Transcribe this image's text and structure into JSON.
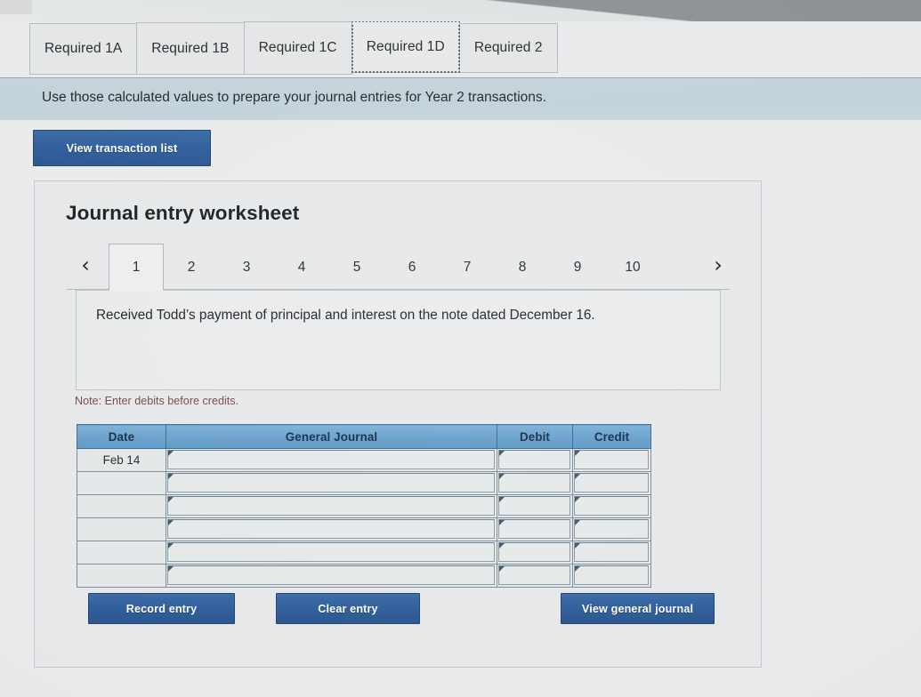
{
  "required_tabs": [
    {
      "label": "Required 1A",
      "active": false
    },
    {
      "label": "Required 1B",
      "active": false
    },
    {
      "label": "Required 1C",
      "active": false
    },
    {
      "label": "Required 1D",
      "active": true
    },
    {
      "label": "Required 2",
      "active": false
    }
  ],
  "instruction": "Use those calculated values to prepare your journal entries for Year 2 transactions.",
  "view_transaction_button": "View transaction list",
  "panel": {
    "title": "Journal entry worksheet",
    "pager": {
      "prev_icon": "chevron-left-icon",
      "next_icon": "chevron-right-icon",
      "prev_glyph": "‹",
      "next_glyph": "›",
      "pages": [
        "1",
        "2",
        "3",
        "4",
        "5",
        "6",
        "7",
        "8",
        "9",
        "10"
      ],
      "active_page": "1"
    },
    "description": "Received Todd’s payment of principal and interest on the note dated December 16.",
    "note": "Note: Enter debits before credits.",
    "table": {
      "headers": [
        "Date",
        "General Journal",
        "Debit",
        "Credit"
      ],
      "rows": [
        {
          "date": "Feb 14",
          "general_journal": "",
          "debit": "",
          "credit": ""
        },
        {
          "date": "",
          "general_journal": "",
          "debit": "",
          "credit": ""
        },
        {
          "date": "",
          "general_journal": "",
          "debit": "",
          "credit": ""
        },
        {
          "date": "",
          "general_journal": "",
          "debit": "",
          "credit": ""
        },
        {
          "date": "",
          "general_journal": "",
          "debit": "",
          "credit": ""
        },
        {
          "date": "",
          "general_journal": "",
          "debit": "",
          "credit": ""
        }
      ]
    },
    "buttons": {
      "record": "Record entry",
      "clear": "Clear entry",
      "view_general_journal": "View general journal"
    }
  },
  "colors": {
    "button_blue": "#2f5d9b",
    "instruction_bar": "#c3d2da",
    "table_header_blue": "#6aa2cd",
    "note_text": "#7a4a4a",
    "panel_background": "#e6e8e9"
  }
}
